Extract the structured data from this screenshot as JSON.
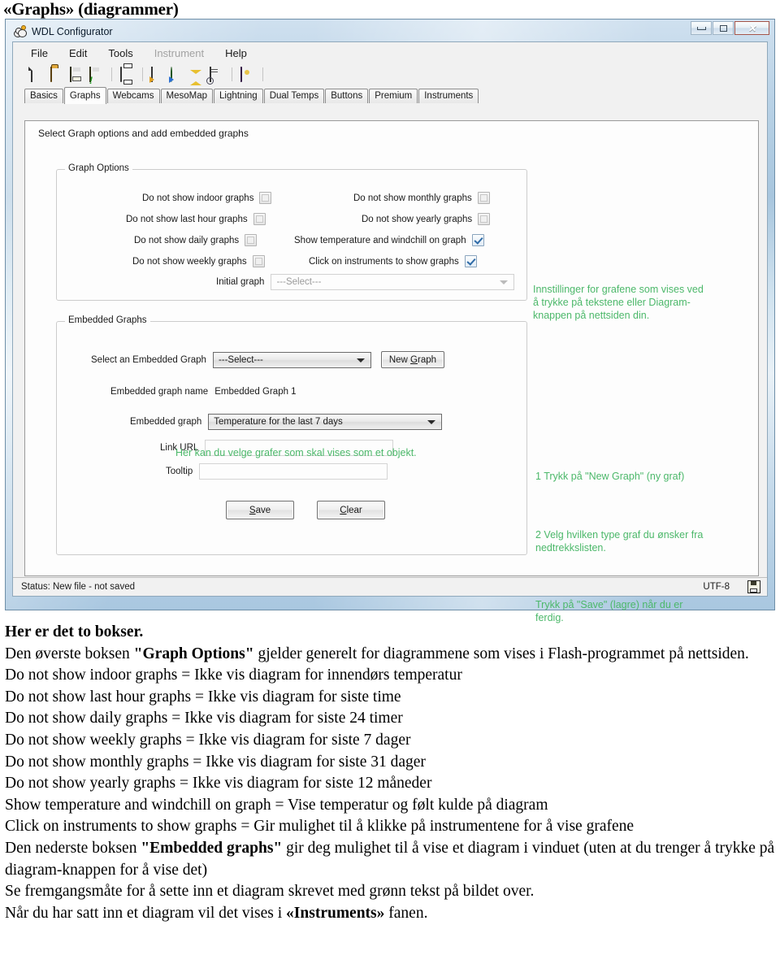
{
  "page": {
    "heading": "«Graphs» (diagrammer)"
  },
  "window": {
    "title": "WDL Configurator",
    "app_icon": "sheep-icon",
    "buttons": {
      "minimize": "minimize-icon",
      "maximize": "maximize-icon",
      "close": "✕"
    },
    "menu": [
      {
        "label": "File",
        "disabled": false
      },
      {
        "label": "Edit",
        "disabled": false
      },
      {
        "label": "Tools",
        "disabled": false
      },
      {
        "label": "Instrument",
        "disabled": true
      },
      {
        "label": "Help",
        "disabled": false
      }
    ],
    "toolbar": [
      {
        "name": "new-file-icon"
      },
      {
        "name": "open-file-icon"
      },
      {
        "name": "save-icon"
      },
      {
        "name": "save-as-icon"
      },
      {
        "name": "print-icon"
      },
      {
        "name": "form-wizard-icon"
      },
      {
        "name": "publish-web-icon"
      },
      {
        "name": "favorites-icon"
      },
      {
        "name": "preview-icon"
      },
      {
        "name": "help-book-icon"
      }
    ],
    "tabs": [
      {
        "label": "Basics",
        "active": false
      },
      {
        "label": "Graphs",
        "active": true
      },
      {
        "label": "Webcams",
        "active": false
      },
      {
        "label": "MesoMap",
        "active": false
      },
      {
        "label": "Lightning",
        "active": false
      },
      {
        "label": "Dual Temps",
        "active": false
      },
      {
        "label": "Buttons",
        "active": false
      },
      {
        "label": "Premium",
        "active": false
      },
      {
        "label": "Instruments",
        "active": false
      }
    ],
    "tab_page_title": "Select Graph options and add embedded graphs",
    "statusbar": {
      "status": "Status: New file - not saved",
      "encoding": "UTF-8",
      "save_icon": "floppy-disk-icon"
    }
  },
  "graph_options": {
    "legend": "Graph Options",
    "checkboxes": [
      {
        "label": "Do not show indoor graphs",
        "checked": false,
        "highlighted": true
      },
      {
        "label": "Do not show last hour graphs",
        "checked": false,
        "highlighted": false
      },
      {
        "label": "Do not show daily graphs",
        "checked": false,
        "highlighted": false
      },
      {
        "label": "Do not show weekly graphs",
        "checked": false,
        "highlighted": false
      },
      {
        "label": "Do not show monthly graphs",
        "checked": false,
        "highlighted": false
      },
      {
        "label": "Do not show yearly graphs",
        "checked": false,
        "highlighted": false
      },
      {
        "label": "Show temperature and windchill on graph",
        "checked": true,
        "highlighted": false
      },
      {
        "label": "Click on instruments to show graphs",
        "checked": true,
        "highlighted": false
      }
    ],
    "initial_graph": {
      "label": "Initial graph",
      "value": "---Select---",
      "disabled": true
    }
  },
  "embedded_graphs": {
    "legend": "Embedded Graphs",
    "select_label": "Select an Embedded Graph",
    "select_value": "---Select---",
    "new_graph_button": "New Graph",
    "name_label": "Embedded graph name",
    "name_value": "Embedded Graph 1",
    "graph_label": "Embedded graph",
    "graph_value": "Temperature for the last 7 days",
    "link_label": "Link URL",
    "link_value": "",
    "tooltip_label": "Tooltip",
    "tooltip_value": "",
    "save_button": "Save",
    "clear_button": "Clear"
  },
  "annotations": {
    "color": "#4cb86a",
    "top_right": "Innstillinger for grafene som vises ved\nå trykke på tekstene eller Diagram-\nknappen på nettsiden din.",
    "inline": "Her kan du velge grafer som skal vises som et objekt.",
    "step1": "1 Trykk på \"New Graph\" (ny graf)",
    "step2": "2 Velg hvilken type graf du ønsker fra\nnedtrekkslisten.",
    "step3": "Trykk på \"Save\" (lagre) når du er\nferdig."
  },
  "body_text": {
    "h1": "Her er det to bokser.",
    "p1_a": "Den øverste boksen ",
    "p1_b": "\"Graph Options\"",
    "p1_c": " gjelder generelt for diagrammene som vises i Flash-programmet på nettsiden.",
    "lines": [
      "Do not show indoor graphs = Ikke vis diagram for innendørs temperatur",
      "Do not show last hour graphs = Ikke vis diagram for siste time",
      "Do not show daily graphs = Ikke vis diagram for siste 24 timer",
      "Do not show weekly graphs = Ikke vis diagram for siste 7 dager",
      "Do not show monthly graphs = Ikke vis diagram for siste 31 dager",
      "Do not show yearly graphs = Ikke vis diagram for siste 12 måneder",
      "Show temperature and windchill on graph = Vise temperatur og følt kulde på diagram",
      "Click on instruments to show graphs = Gir mulighet til å klikke på instrumentene for å vise grafene"
    ],
    "p2_a": "Den nederste boksen ",
    "p2_b": "\"Embedded graphs\"",
    "p2_c": " gir deg mulighet til å vise et diagram i vinduet (uten at du trenger å trykke på diagram-knappen for å vise det)",
    "p3": "Se fremgangsmåte for å sette inn et diagram skrevet med grønn tekst på bildet over.",
    "p4_a": "Når du har satt inn et diagram vil det vises i ",
    "p4_b": "«Instruments»",
    "p4_c": " fanen."
  }
}
